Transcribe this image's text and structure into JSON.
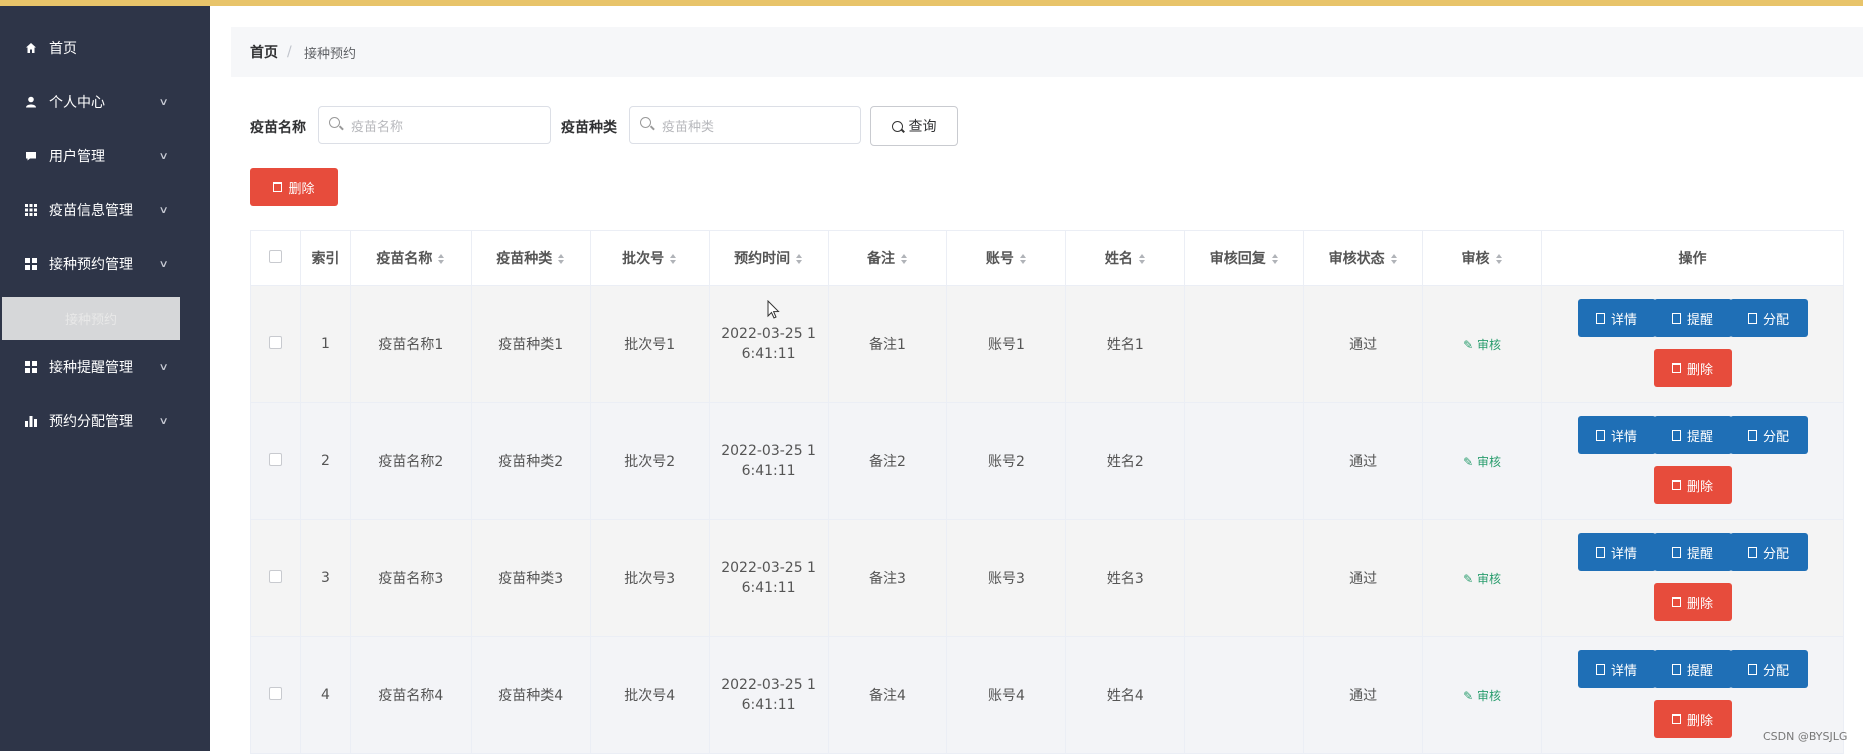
{
  "sidebar": {
    "items": [
      {
        "label": "首页",
        "icon": "home-icon",
        "has_arrow": false
      },
      {
        "label": "个人中心",
        "icon": "user-icon",
        "has_arrow": true
      },
      {
        "label": "用户管理",
        "icon": "chat-icon",
        "has_arrow": true
      },
      {
        "label": "疫苗信息管理",
        "icon": "grid-icon",
        "has_arrow": true
      },
      {
        "label": "接种预约管理",
        "icon": "apps-icon",
        "has_arrow": true
      },
      {
        "label": "接种提醒管理",
        "icon": "apps-icon",
        "has_arrow": true
      },
      {
        "label": "预约分配管理",
        "icon": "bar-chart-icon",
        "has_arrow": true
      }
    ],
    "active_sub": "接种预约"
  },
  "breadcrumb": {
    "home": "首页",
    "separator": "/",
    "current": "接种预约"
  },
  "search": {
    "name_label": "疫苗名称",
    "name_placeholder": "疫苗名称",
    "type_label": "疫苗种类",
    "type_placeholder": "疫苗种类",
    "query_button": "查询"
  },
  "toolbar": {
    "delete_label": "删除"
  },
  "table": {
    "headers": [
      "索引",
      "疫苗名称",
      "疫苗种类",
      "批次号",
      "预约时间",
      "备注",
      "账号",
      "姓名",
      "审核回复",
      "审核状态",
      "审核",
      "操作"
    ],
    "rows": [
      {
        "index": "1",
        "name": "疫苗名称1",
        "type": "疫苗种类1",
        "batch": "批次号1",
        "time_line1": "2022-03-25 1",
        "time_line2": "6:41:11",
        "note": "备注1",
        "account": "账号1",
        "person": "姓名1",
        "reply": "",
        "status": "通过",
        "audit": "审核"
      },
      {
        "index": "2",
        "name": "疫苗名称2",
        "type": "疫苗种类2",
        "batch": "批次号2",
        "time_line1": "2022-03-25 1",
        "time_line2": "6:41:11",
        "note": "备注2",
        "account": "账号2",
        "person": "姓名2",
        "reply": "",
        "status": "通过",
        "audit": "审核"
      },
      {
        "index": "3",
        "name": "疫苗名称3",
        "type": "疫苗种类3",
        "batch": "批次号3",
        "time_line1": "2022-03-25 1",
        "time_line2": "6:41:11",
        "note": "备注3",
        "account": "账号3",
        "person": "姓名3",
        "reply": "",
        "status": "通过",
        "audit": "审核"
      },
      {
        "index": "4",
        "name": "疫苗名称4",
        "type": "疫苗种类4",
        "batch": "批次号4",
        "time_line1": "2022-03-25 1",
        "time_line2": "6:41:11",
        "note": "备注4",
        "account": "账号4",
        "person": "姓名4",
        "reply": "",
        "status": "通过",
        "audit": "审核"
      }
    ],
    "actions": {
      "detail": "详情",
      "remind": "提醒",
      "assign": "分配",
      "delete": "删除"
    }
  },
  "watermark": "CSDN @BYSJLG",
  "colors": {
    "sidebar_bg": "#2e3548",
    "primary": "#1f6fb6",
    "danger": "#e74c3c",
    "success": "#2a9d6e",
    "top_bar": "#e8c46a"
  }
}
